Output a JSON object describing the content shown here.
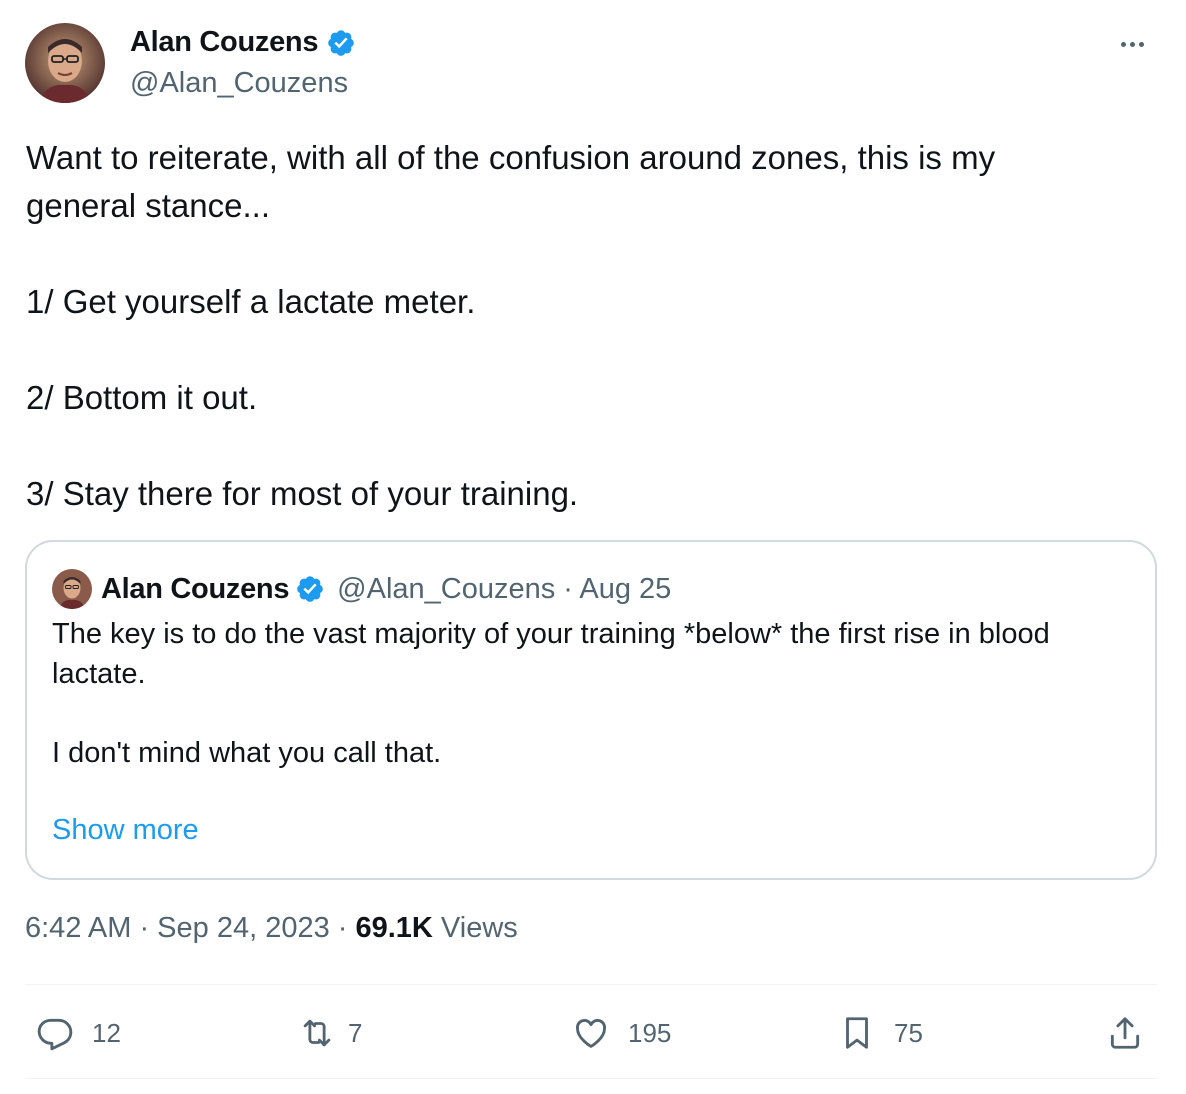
{
  "author": {
    "name": "Alan Couzens",
    "handle": "@Alan_Couzens"
  },
  "tweet": {
    "line1": "Want to reiterate, with all of the confusion around zones, this is my",
    "line2": "general stance...",
    "point1": "1/ Get yourself a lactate meter.",
    "point2": "2/ Bottom it out.",
    "point3": "3/ Stay there for most of your training."
  },
  "quote": {
    "name": "Alan Couzens",
    "handle_date": "@Alan_Couzens · Aug 25",
    "line1": "The key is to do the vast majority of your training *below* the first rise in blood",
    "line2": "lactate.",
    "line3": "I don't mind what you call that.",
    "show_more": "Show more"
  },
  "meta": {
    "time_date": "6:42 AM · Sep 24, 2023 · ",
    "views_count": "69.1K",
    "views_label": " Views"
  },
  "actions": {
    "replies": "12",
    "reposts": "7",
    "likes": "195",
    "bookmarks": "75"
  },
  "colors": {
    "verified": "#1d9bf0",
    "link": "#1d9bf0",
    "secondary_text": "#536471"
  },
  "icons": [
    "more-icon",
    "verified-icon",
    "reply-icon",
    "repost-icon",
    "like-icon",
    "bookmark-icon",
    "share-icon"
  ]
}
